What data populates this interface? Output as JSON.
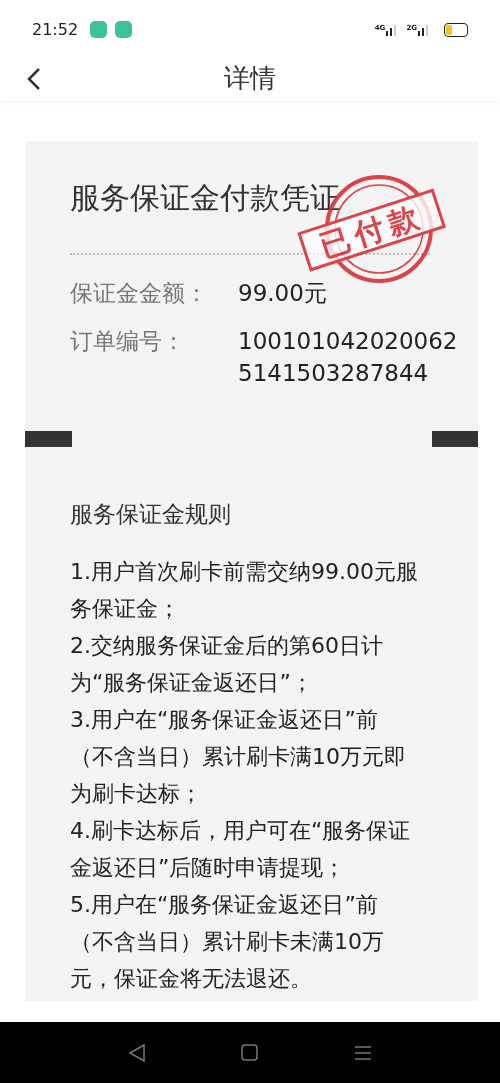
{
  "status_bar": {
    "time": "21:52",
    "networks": [
      "4G",
      "2G"
    ]
  },
  "header": {
    "title": "详情"
  },
  "receipt": {
    "title": "服务保证金付款凭证",
    "stamp": "已付款",
    "fields": [
      {
        "label": "保证金金额：",
        "value": "99.00元"
      },
      {
        "label": "订单编号：",
        "value": "100101042020062 5141503287844"
      }
    ]
  },
  "rules": {
    "title": "服务保证金规则",
    "items": [
      "1.用户首次刷卡前需交纳99.00元服务保证金；",
      "2.交纳服务保证金后的第60日计为“服务保证金返还日”；",
      "3.用户在“服务保证金返还日”前（不含当日）累计刷卡满10万元即为刷卡达标；",
      "4.刷卡达标后，用户可在“服务保证金返还日”后随时申请提现；",
      "5.用户在“服务保证金返还日”前（不含当日）累计刷卡未满10万元，保证金将无法退还。"
    ]
  }
}
